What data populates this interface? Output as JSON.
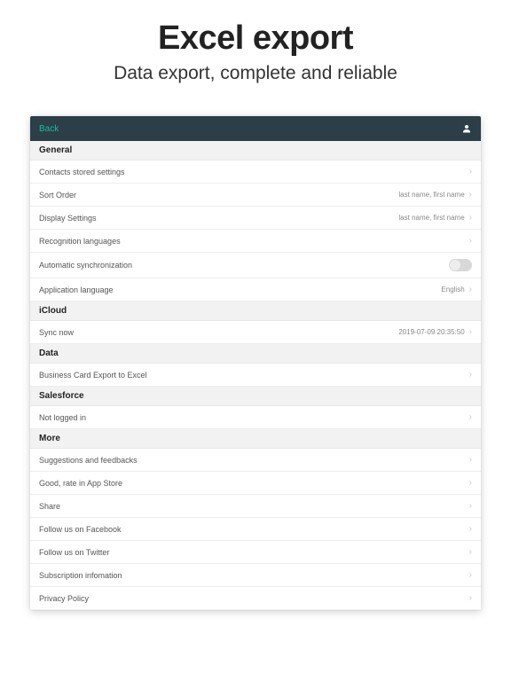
{
  "hero": {
    "title": "Excel export",
    "subtitle": "Data export, complete and reliable"
  },
  "nav": {
    "back": "Back"
  },
  "sections": {
    "general": {
      "header": "General",
      "contacts": "Contacts stored settings",
      "sort_order": {
        "label": "Sort Order",
        "value": "last name,  first name"
      },
      "display": {
        "label": "Display Settings",
        "value": "last name,  first name"
      },
      "recognition": "Recognition languages",
      "auto_sync": "Automatic synchronization",
      "app_lang": {
        "label": "Application language",
        "value": "English"
      }
    },
    "icloud": {
      "header": "iCloud",
      "sync": {
        "label": "Sync now",
        "value": "2019-07-09 20:35:50"
      }
    },
    "data": {
      "header": "Data",
      "export": "Business Card Export to Excel"
    },
    "salesforce": {
      "header": "Salesforce",
      "status": "Not logged in"
    },
    "more": {
      "header": "More",
      "suggestions": "Suggestions and feedbacks",
      "rate": "Good, rate in App Store",
      "share": "Share",
      "facebook": "Follow us on Facebook",
      "twitter": "Follow us on Twitter",
      "subscription": "Subscription infomation",
      "privacy": "Privacy Policy"
    }
  }
}
